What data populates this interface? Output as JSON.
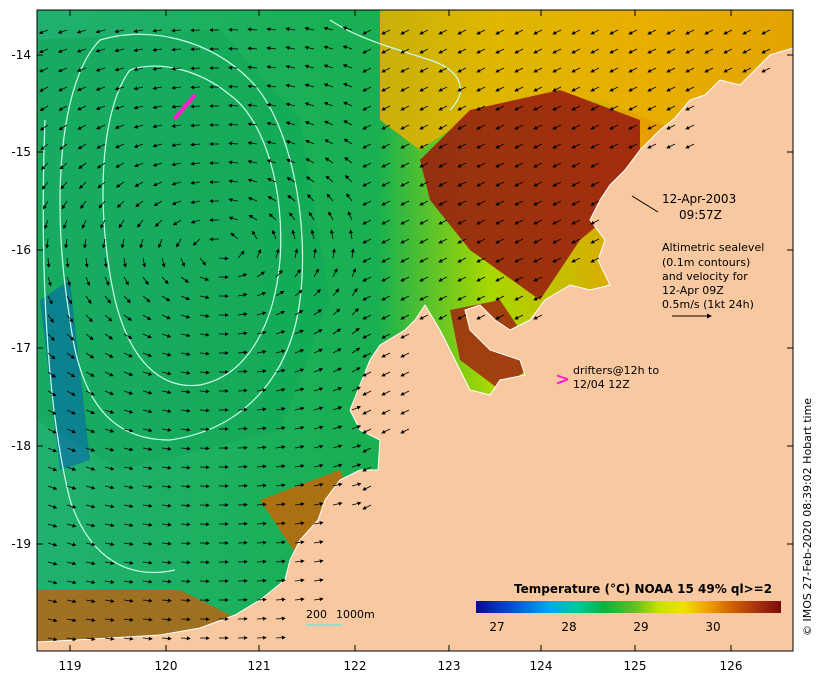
{
  "map": {
    "x_ticks": [
      "119",
      "120",
      "121",
      "122",
      "123",
      "124",
      "125",
      "126"
    ],
    "y_ticks": [
      "-14",
      "-15",
      "-16",
      "-17",
      "-18",
      "-19"
    ]
  },
  "annotations": {
    "date": "12-Apr-2003",
    "time": "09:57Z",
    "altimetry": [
      "Altimetric sealevel",
      "(0.1m contours)",
      "and velocity for",
      "12-Apr 09Z",
      "0.5m/s (1kt 24h)"
    ],
    "drifters": [
      "drifters@12h to",
      "12/04 12Z"
    ],
    "depth": [
      "200",
      "1000m"
    ]
  },
  "legend": {
    "title": "Temperature (°C) NOAA 15 49% ql>=2",
    "ticks": [
      "27",
      "28",
      "29",
      "30"
    ],
    "colors": [
      "#0a0a8c",
      "#0050d0",
      "#00a8e8",
      "#00c8a0",
      "#10b040",
      "#60c020",
      "#c8e000",
      "#f0e000",
      "#f0a000",
      "#d06000",
      "#a83010",
      "#7a0a0a"
    ]
  },
  "credit": "© IMOS 27-Feb-2020 08:39:02 Hobart time",
  "colors": {
    "land": "#f8c8a0",
    "contour": "#c8ffe8",
    "drifter": "#ff20d0"
  }
}
